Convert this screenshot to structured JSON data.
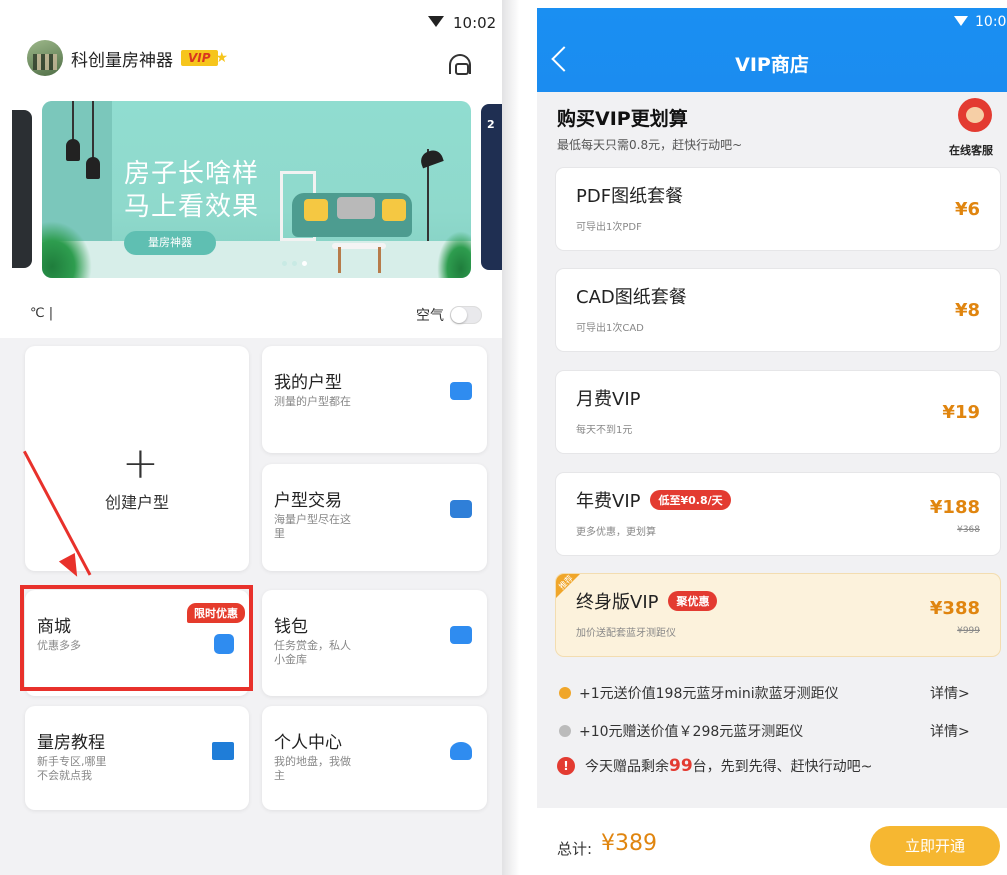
{
  "left": {
    "status_time": "10:02",
    "app": {
      "name": "科创量房神器",
      "vip": "VIP"
    },
    "banner": {
      "line1": "房子长啥样",
      "line2": "马上看效果",
      "button": "量房神器",
      "next_peek": "2"
    },
    "weather": {
      "temp": "℃ |",
      "air": "空气"
    },
    "create": {
      "label": "创建户型"
    },
    "cards": {
      "my_plan": {
        "title": "我的户型",
        "sub": "测量的户型都在"
      },
      "trade": {
        "title": "户型交易",
        "sub": "海量户型尽在这里"
      },
      "mall": {
        "title": "商城",
        "sub": "优惠多多",
        "badge": "限时优惠"
      },
      "wallet": {
        "title": "钱包",
        "sub": "任务赏金，私人小金库"
      },
      "tutorial": {
        "title": "量房教程",
        "sub": "新手专区,哪里不会就点我"
      },
      "profile": {
        "title": "个人中心",
        "sub": "我的地盘，我做主"
      }
    }
  },
  "right": {
    "status_time": "10:0",
    "title": "VIP商店",
    "promo": {
      "title": "购买VIP更划算",
      "sub": "最低每天只需0.8元，赶快行动吧~",
      "cs_label": "在线客服"
    },
    "packages": [
      {
        "name": "PDF图纸套餐",
        "desc": "可导出1次PDF",
        "price": "¥6"
      },
      {
        "name": "CAD图纸套餐",
        "desc": "可导出1次CAD",
        "price": "¥8"
      },
      {
        "name": "月费VIP",
        "desc": "每天不到1元",
        "price": "¥19"
      },
      {
        "name": "年费VIP",
        "desc": "更多优惠，更划算",
        "price": "¥188",
        "orig": "¥368",
        "tag": "低至¥0.8/天"
      },
      {
        "name": "终身版VIP",
        "desc": "加价送配套蓝牙测距仪",
        "price": "¥388",
        "orig": "¥999",
        "tag": "聚优惠",
        "corner": "推荐"
      }
    ],
    "gifts": [
      {
        "text": "+1元送价值198元蓝牙mini款蓝牙测距仪",
        "detail": "详情>",
        "check_color": "#f0a62a"
      },
      {
        "text": "+10元赠送价值￥298元蓝牙测距仪",
        "detail": "详情>",
        "check_color": "#bbbbbb"
      }
    ],
    "notice": {
      "icon": "!",
      "before": "今天赠品剩余",
      "num": "99",
      "after": "台，先到先得、赶快行动吧~"
    },
    "footer": {
      "total_label": "总计:",
      "total_value": "¥389",
      "button": "立即开通"
    }
  }
}
